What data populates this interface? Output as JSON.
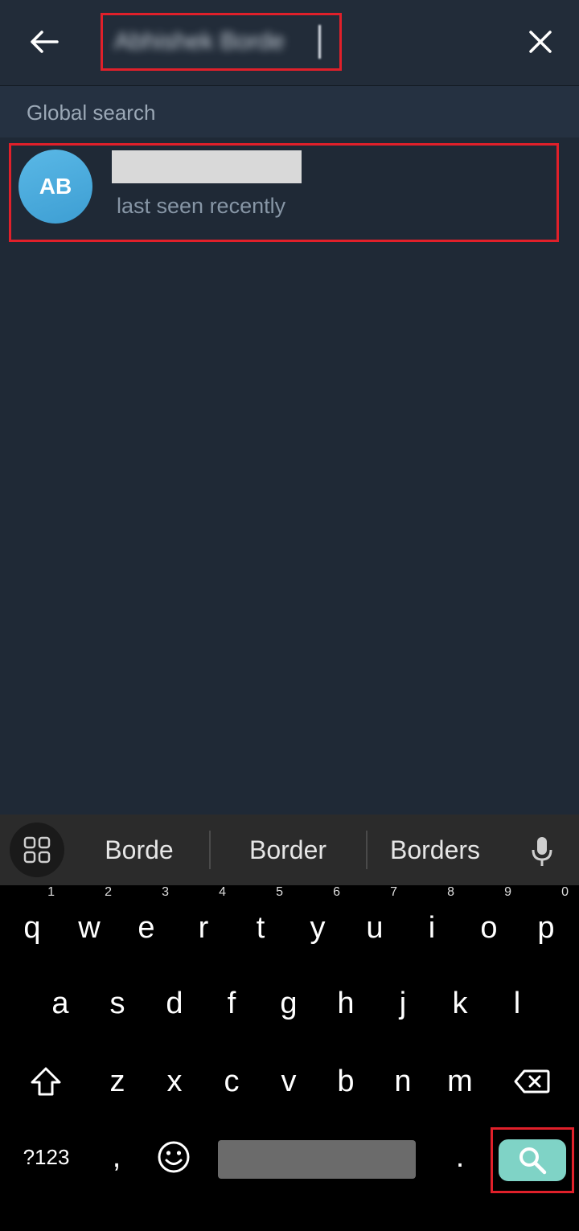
{
  "search": {
    "query": "Abhishek Borde"
  },
  "section": {
    "title": "Global search"
  },
  "result": {
    "initials": "AB",
    "status": "last seen recently"
  },
  "keyboard": {
    "suggestions": [
      "Borde",
      "Border",
      "Borders"
    ],
    "row1": [
      {
        "k": "q",
        "n": "1"
      },
      {
        "k": "w",
        "n": "2"
      },
      {
        "k": "e",
        "n": "3"
      },
      {
        "k": "r",
        "n": "4"
      },
      {
        "k": "t",
        "n": "5"
      },
      {
        "k": "y",
        "n": "6"
      },
      {
        "k": "u",
        "n": "7"
      },
      {
        "k": "i",
        "n": "8"
      },
      {
        "k": "o",
        "n": "9"
      },
      {
        "k": "p",
        "n": "0"
      }
    ],
    "row2": [
      "a",
      "s",
      "d",
      "f",
      "g",
      "h",
      "j",
      "k",
      "l"
    ],
    "row3": [
      "z",
      "x",
      "c",
      "v",
      "b",
      "n",
      "m"
    ],
    "symbols_label": "?123",
    "comma": ",",
    "period": "."
  },
  "colors": {
    "accent_highlight": "#e0202a",
    "avatar": "#4aaee0",
    "search_key": "#7fd3c6"
  }
}
